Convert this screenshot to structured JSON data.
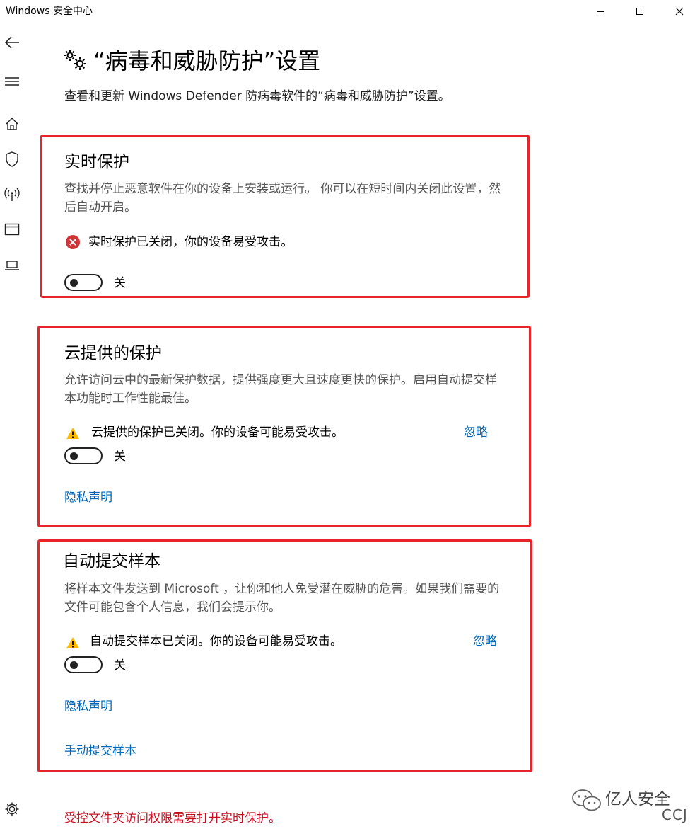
{
  "window": {
    "title": "Windows 安全中心",
    "controls": [
      "minimize-icon",
      "maximize-icon",
      "close-icon"
    ]
  },
  "sidebar": {
    "items": [
      {
        "icon": "back-arrow-icon"
      },
      {
        "icon": "hamburger-menu-icon"
      },
      {
        "icon": "home-icon"
      },
      {
        "icon": "shield-icon"
      },
      {
        "icon": "wireless-signal-icon"
      },
      {
        "icon": "app-browser-icon"
      },
      {
        "icon": "laptop-icon"
      }
    ],
    "footer_icon": "gear-icon"
  },
  "page": {
    "icon": "gears-icon",
    "title": "“病毒和威胁防护”设置",
    "subtitle": "查看和更新 Windows Defender 防病毒软件的“病毒和威胁防护”设置。"
  },
  "sections": {
    "realtime": {
      "title": "实时保护",
      "description": "查找并停止恶意软件在你的设备上安装或运行。 你可以在短时间内关闭此设置，然后自动开启。",
      "status_icon": "error-circle-icon",
      "status_text": "实时保护已关闭，你的设备易受攻击。",
      "toggle_state": "关",
      "toggle_on": false
    },
    "cloud": {
      "title": "云提供的保护",
      "description": "允许访问云中的最新保护数据，提供强度更大且速度更快的保护。启用自动提交样本功能时工作性能最佳。",
      "status_icon": "warning-triangle-icon",
      "status_text": "云提供的保护已关闭。你的设备可能易受攻击。",
      "dismiss_label": "忽略",
      "toggle_state": "关",
      "toggle_on": false,
      "privacy_link": "隐私声明"
    },
    "sample": {
      "title": "自动提交样本",
      "description": "将样本文件发送到 Microsoft ，让你和他人免受潜在威胁的危害。如果我们需要的文件可能包含个人信息，我们会提示你。",
      "status_icon": "warning-triangle-icon",
      "status_text": "自动提交样本已关闭。你的设备可能易受攻击。",
      "dismiss_label": "忽略",
      "toggle_state": "关",
      "toggle_on": false,
      "privacy_link": "隐私声明",
      "manual_link": "手动提交样本"
    }
  },
  "footer": {
    "warning": "受控文件夹访问权限需要打开实时保护。"
  },
  "watermark": {
    "text": "亿人安全",
    "sub": "CCJ"
  },
  "colors": {
    "highlight_border": "#e8232a",
    "link": "#0067b8",
    "error": "#d13438",
    "warning": "#ffb900",
    "footer_warning": "#c50f1f"
  }
}
